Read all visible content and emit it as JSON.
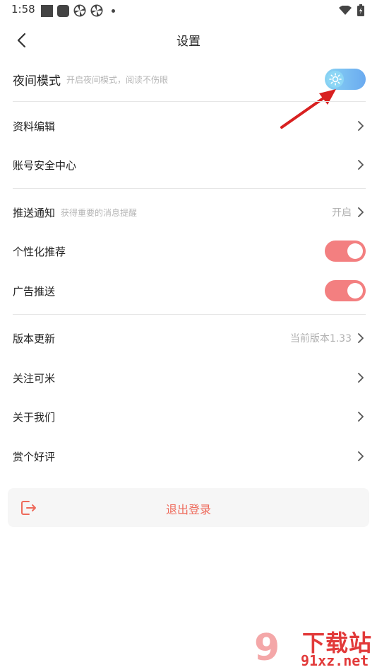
{
  "status_bar": {
    "time": "1:58"
  },
  "nav": {
    "title": "设置"
  },
  "night_mode": {
    "label": "夜间模式",
    "hint": "开启夜间模式，阅读不伤眼",
    "enabled": false
  },
  "profile_edit": {
    "label": "资料编辑"
  },
  "account_security": {
    "label": "账号安全中心"
  },
  "push_notifications": {
    "label": "推送通知",
    "hint": "获得重要的消息提醒",
    "value": "开启"
  },
  "personalized_recommend": {
    "label": "个性化推荐",
    "enabled": true
  },
  "ad_push": {
    "label": "广告推送",
    "enabled": true
  },
  "version_update": {
    "label": "版本更新",
    "value": "当前版本1.33"
  },
  "follow_kemi": {
    "label": "关注可米"
  },
  "about_us": {
    "label": "关于我们"
  },
  "rate_app": {
    "label": "赏个好评"
  },
  "logout": {
    "label": "退出登录"
  },
  "watermark": {
    "brand": "下载站",
    "domain": "91xz.net"
  },
  "colors": {
    "toggle_on": "#f37f80",
    "night_toggle": "#6aaaf0",
    "logout_text": "#ee6a5b",
    "annotation_arrow": "#d82020"
  }
}
